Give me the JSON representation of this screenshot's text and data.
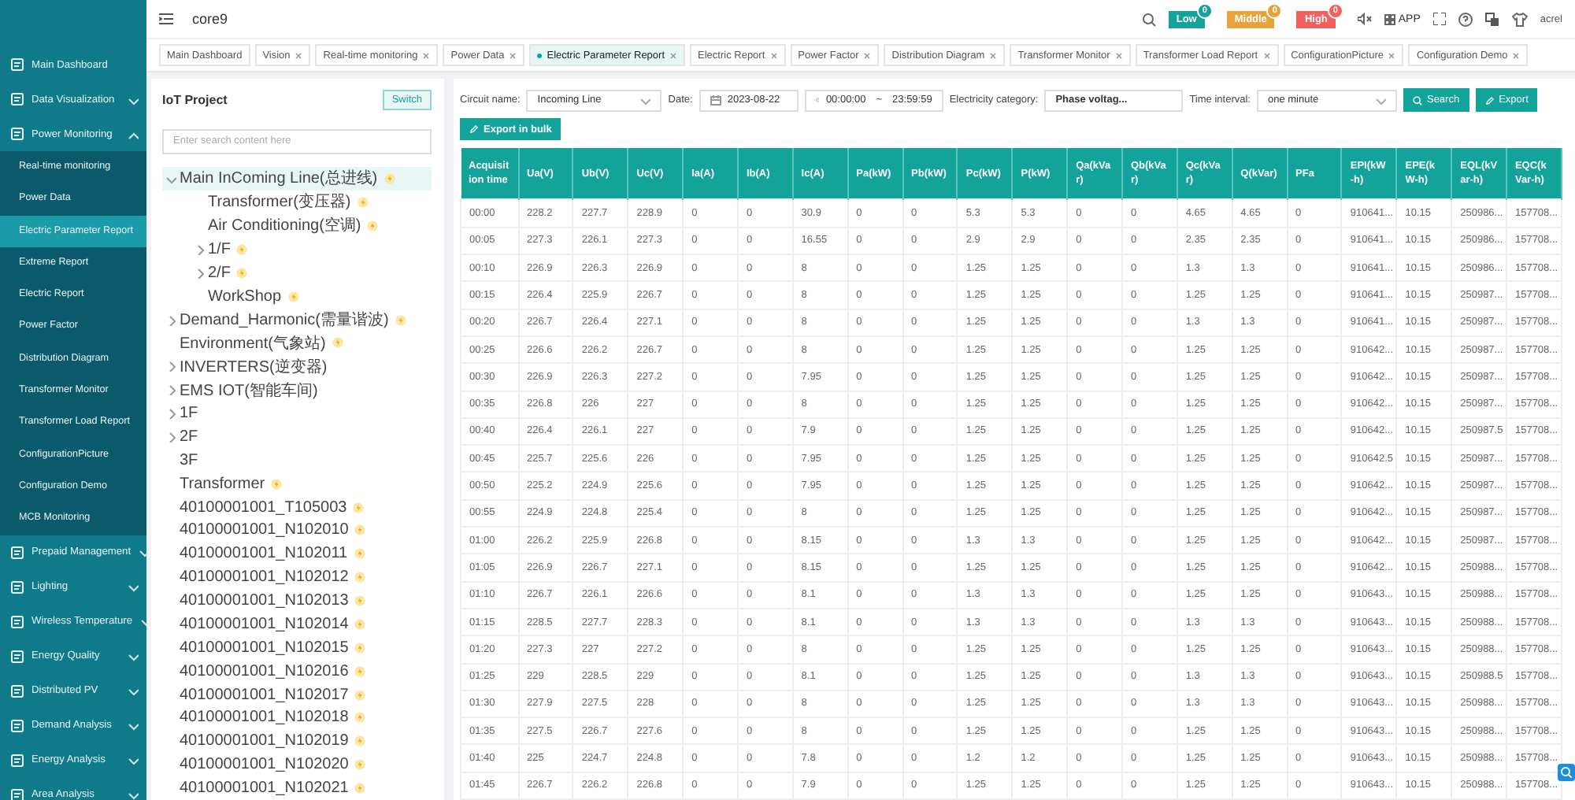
{
  "sidebar": {
    "items": [
      {
        "label": "Main Dashboard"
      },
      {
        "label": "Data Visualization",
        "expanded": false
      },
      {
        "label": "Power Monitoring",
        "expanded": true,
        "children": [
          {
            "label": "Real-time monitoring",
            "selected": false
          },
          {
            "label": "Power Data",
            "selected": false
          },
          {
            "label": "Electric Parameter Report",
            "selected": true
          },
          {
            "label": "Extreme Report",
            "selected": false
          },
          {
            "label": "Electric Report",
            "selected": false
          },
          {
            "label": "Power Factor",
            "selected": false
          },
          {
            "label": "Distribution Diagram",
            "selected": false
          },
          {
            "label": "Transformer Monitor",
            "selected": false
          },
          {
            "label": "Transformer Load Report",
            "selected": false
          },
          {
            "label": "ConfigurationPicture",
            "selected": false
          },
          {
            "label": "Configuration Demo",
            "selected": false
          },
          {
            "label": "MCB Monitoring",
            "selected": false
          }
        ]
      },
      {
        "label": "Prepaid Management",
        "expanded": false
      },
      {
        "label": "Lighting",
        "expanded": false
      },
      {
        "label": "Wireless Temperature",
        "expanded": false
      },
      {
        "label": "Energy Quality",
        "expanded": false
      },
      {
        "label": "Distributed PV",
        "expanded": false
      },
      {
        "label": "Demand Analysis",
        "expanded": false
      },
      {
        "label": "Energy Analysis",
        "expanded": false
      },
      {
        "label": "Area Analysis",
        "expanded": false
      }
    ]
  },
  "header": {
    "title": "core9",
    "alerts": [
      {
        "label": "Low",
        "count": "0",
        "color": "#14a39a"
      },
      {
        "label": "Middle",
        "count": "0",
        "color": "#e8a23a"
      },
      {
        "label": "High",
        "count": "0",
        "color": "#f0605d"
      }
    ],
    "app_label": "APP",
    "user": "acrel"
  },
  "tabs": [
    {
      "label": "Main Dashboard",
      "closable": false,
      "selected": false
    },
    {
      "label": "Vision",
      "closable": true,
      "selected": false
    },
    {
      "label": "Real-time monitoring",
      "closable": true,
      "selected": false
    },
    {
      "label": "Power Data",
      "closable": true,
      "selected": false
    },
    {
      "label": "Electric Parameter Report",
      "closable": true,
      "selected": true
    },
    {
      "label": "Electric Report",
      "closable": true,
      "selected": false
    },
    {
      "label": "Power Factor",
      "closable": true,
      "selected": false
    },
    {
      "label": "Distribution Diagram",
      "closable": true,
      "selected": false
    },
    {
      "label": "Transformer Monitor",
      "closable": true,
      "selected": false
    },
    {
      "label": "Transformer Load Report",
      "closable": true,
      "selected": false
    },
    {
      "label": "ConfigurationPicture",
      "closable": true,
      "selected": false
    },
    {
      "label": "Configuration Demo",
      "closable": true,
      "selected": false
    }
  ],
  "project_panel": {
    "title": "IoT Project",
    "switch_button": "Switch",
    "search": {
      "placeholder": "Enter search content here"
    },
    "tree": [
      {
        "label": "Main InComing Line(总进线)",
        "marked": true,
        "selected": true,
        "expanded": true,
        "children": [
          {
            "label": "Transformer(变压器)",
            "marked": true,
            "selected": false
          },
          {
            "label": "Air Conditioning(空调)",
            "marked": true,
            "selected": false
          },
          {
            "label": "1/F",
            "marked": true,
            "selected": false,
            "expanded": false
          },
          {
            "label": "2/F",
            "marked": true,
            "selected": false,
            "expanded": false
          },
          {
            "label": "WorkShop",
            "marked": true,
            "selected": false
          }
        ]
      },
      {
        "label": "Demand_Harmonic(需量谐波)",
        "marked": true,
        "selected": false,
        "expanded": false
      },
      {
        "label": "Environment(气象站)",
        "marked": true,
        "selected": false
      },
      {
        "label": "INVERTERS(逆变器)",
        "marked": false,
        "selected": false,
        "expanded": false
      },
      {
        "label": "EMS IOT(智能车间)",
        "marked": false,
        "selected": false,
        "expanded": false
      },
      {
        "label": "1F",
        "marked": false,
        "selected": false,
        "expanded": false
      },
      {
        "label": "2F",
        "marked": false,
        "selected": false,
        "expanded": false
      },
      {
        "label": "3F",
        "marked": false,
        "selected": false
      },
      {
        "label": "Transformer",
        "marked": true,
        "selected": false
      },
      {
        "label": "40100001001_T105003",
        "marked": true,
        "selected": false
      },
      {
        "label": "40100001001_N102010",
        "marked": true,
        "selected": false
      },
      {
        "label": "40100001001_N102011",
        "marked": true,
        "selected": false
      },
      {
        "label": "40100001001_N102012",
        "marked": true,
        "selected": false
      },
      {
        "label": "40100001001_N102013",
        "marked": true,
        "selected": false
      },
      {
        "label": "40100001001_N102014",
        "marked": true,
        "selected": false
      },
      {
        "label": "40100001001_N102015",
        "marked": true,
        "selected": false
      },
      {
        "label": "40100001001_N102016",
        "marked": true,
        "selected": false
      },
      {
        "label": "40100001001_N102017",
        "marked": true,
        "selected": false
      },
      {
        "label": "40100001001_N102018",
        "marked": true,
        "selected": false
      },
      {
        "label": "40100001001_N102019",
        "marked": true,
        "selected": false
      },
      {
        "label": "40100001001_N102020",
        "marked": true,
        "selected": false
      },
      {
        "label": "40100001001_N102021",
        "marked": true,
        "selected": false
      }
    ]
  },
  "report": {
    "filters": {
      "circuit_name": {
        "label": "Circuit name:",
        "value": "Incoming Line"
      },
      "date": {
        "label": "Date:",
        "value": "2023-08-22"
      },
      "time_range": {
        "start": "00:00:00",
        "separator": "~",
        "end": "23:59:59"
      },
      "electricity_category": {
        "label": "Electricity category:",
        "value": "Phase voltag..."
      },
      "time_interval": {
        "label": "Time interval:",
        "value": "one minute"
      }
    },
    "buttons": {
      "search": "Search",
      "export": "Export",
      "export_bulk": "Export in bulk"
    },
    "table": {
      "columns": [
        "Acquisition time",
        "Ua(V)",
        "Ub(V)",
        "Uc(V)",
        "Ia(A)",
        "Ib(A)",
        "Ic(A)",
        "Pa(kW)",
        "Pb(kW)",
        "Pc(kW)",
        "P(kW)",
        "Qa(kVar)",
        "Qb(kVar)",
        "Qc(kVar)",
        "Q(kVar)",
        "PFa",
        "EPI(kW-h)",
        "EPE(kW-h)",
        "EQL(kVar-h)",
        "EQC(kVar-h)"
      ],
      "rows": [
        [
          "00:00",
          "228.2",
          "227.7",
          "228.9",
          "0",
          "0",
          "30.9",
          "0",
          "0",
          "5.3",
          "5.3",
          "0",
          "0",
          "4.65",
          "4.65",
          "0",
          "910641...",
          "10.15",
          "250986...",
          "157708..."
        ],
        [
          "00:05",
          "227.3",
          "226.1",
          "227.3",
          "0",
          "0",
          "16.55",
          "0",
          "0",
          "2.9",
          "2.9",
          "0",
          "0",
          "2.35",
          "2.35",
          "0",
          "910641...",
          "10.15",
          "250986...",
          "157708..."
        ],
        [
          "00:10",
          "226.9",
          "226.3",
          "226.9",
          "0",
          "0",
          "8",
          "0",
          "0",
          "1.25",
          "1.25",
          "0",
          "0",
          "1.3",
          "1.3",
          "0",
          "910641...",
          "10.15",
          "250986...",
          "157708..."
        ],
        [
          "00:15",
          "226.4",
          "225.9",
          "226.7",
          "0",
          "0",
          "8",
          "0",
          "0",
          "1.25",
          "1.25",
          "0",
          "0",
          "1.25",
          "1.25",
          "0",
          "910641...",
          "10.15",
          "250987...",
          "157708..."
        ],
        [
          "00:20",
          "226.7",
          "226.4",
          "227.1",
          "0",
          "0",
          "8",
          "0",
          "0",
          "1.25",
          "1.25",
          "0",
          "0",
          "1.3",
          "1.3",
          "0",
          "910641...",
          "10.15",
          "250987...",
          "157708..."
        ],
        [
          "00:25",
          "226.6",
          "226.2",
          "226.7",
          "0",
          "0",
          "8",
          "0",
          "0",
          "1.25",
          "1.25",
          "0",
          "0",
          "1.25",
          "1.25",
          "0",
          "910642...",
          "10.15",
          "250987...",
          "157708..."
        ],
        [
          "00:30",
          "226.9",
          "226.3",
          "227.2",
          "0",
          "0",
          "7.95",
          "0",
          "0",
          "1.25",
          "1.25",
          "0",
          "0",
          "1.25",
          "1.25",
          "0",
          "910642...",
          "10.15",
          "250987...",
          "157708..."
        ],
        [
          "00:35",
          "226.8",
          "226",
          "227",
          "0",
          "0",
          "8",
          "0",
          "0",
          "1.25",
          "1.25",
          "0",
          "0",
          "1.25",
          "1.25",
          "0",
          "910642...",
          "10.15",
          "250987...",
          "157708..."
        ],
        [
          "00:40",
          "226.4",
          "226.1",
          "227",
          "0",
          "0",
          "7.9",
          "0",
          "0",
          "1.25",
          "1.25",
          "0",
          "0",
          "1.25",
          "1.25",
          "0",
          "910642...",
          "10.15",
          "250987.5",
          "157708..."
        ],
        [
          "00:45",
          "225.7",
          "225.6",
          "226",
          "0",
          "0",
          "7.95",
          "0",
          "0",
          "1.25",
          "1.25",
          "0",
          "0",
          "1.25",
          "1.25",
          "0",
          "910642.5",
          "10.15",
          "250987...",
          "157708..."
        ],
        [
          "00:50",
          "225.2",
          "224.9",
          "225.6",
          "0",
          "0",
          "7.95",
          "0",
          "0",
          "1.25",
          "1.25",
          "0",
          "0",
          "1.25",
          "1.25",
          "0",
          "910642...",
          "10.15",
          "250987...",
          "157708..."
        ],
        [
          "00:55",
          "224.9",
          "224.8",
          "225.4",
          "0",
          "0",
          "8",
          "0",
          "0",
          "1.25",
          "1.25",
          "0",
          "0",
          "1.25",
          "1.25",
          "0",
          "910642...",
          "10.15",
          "250987...",
          "157708..."
        ],
        [
          "01:00",
          "226.2",
          "225.9",
          "226.8",
          "0",
          "0",
          "8.15",
          "0",
          "0",
          "1.3",
          "1.3",
          "0",
          "0",
          "1.25",
          "1.25",
          "0",
          "910642...",
          "10.15",
          "250987...",
          "157708..."
        ],
        [
          "01:05",
          "226.9",
          "226.7",
          "227.1",
          "0",
          "0",
          "8.15",
          "0",
          "0",
          "1.25",
          "1.25",
          "0",
          "0",
          "1.25",
          "1.25",
          "0",
          "910642...",
          "10.15",
          "250988...",
          "157708..."
        ],
        [
          "01:10",
          "226.7",
          "226.1",
          "226.6",
          "0",
          "0",
          "8.1",
          "0",
          "0",
          "1.3",
          "1.3",
          "0",
          "0",
          "1.25",
          "1.25",
          "0",
          "910643...",
          "10.15",
          "250988...",
          "157708..."
        ],
        [
          "01:15",
          "228.5",
          "227.7",
          "228.3",
          "0",
          "0",
          "8.1",
          "0",
          "0",
          "1.3",
          "1.3",
          "0",
          "0",
          "1.3",
          "1.3",
          "0",
          "910643...",
          "10.15",
          "250988...",
          "157708..."
        ],
        [
          "01:20",
          "227.3",
          "227",
          "227.2",
          "0",
          "0",
          "8",
          "0",
          "0",
          "1.25",
          "1.25",
          "0",
          "0",
          "1.25",
          "1.25",
          "0",
          "910643...",
          "10.15",
          "250988...",
          "157708..."
        ],
        [
          "01:25",
          "229",
          "228.5",
          "229",
          "0",
          "0",
          "8.1",
          "0",
          "0",
          "1.25",
          "1.25",
          "0",
          "0",
          "1.3",
          "1.3",
          "0",
          "910643...",
          "10.15",
          "250988.5",
          "157708..."
        ],
        [
          "01:30",
          "227.9",
          "227.5",
          "228",
          "0",
          "0",
          "8",
          "0",
          "0",
          "1.25",
          "1.25",
          "0",
          "0",
          "1.3",
          "1.3",
          "0",
          "910643...",
          "10.15",
          "250988...",
          "157708..."
        ],
        [
          "01:35",
          "227.5",
          "226.7",
          "227.6",
          "0",
          "0",
          "8",
          "0",
          "0",
          "1.25",
          "1.25",
          "0",
          "0",
          "1.25",
          "1.25",
          "0",
          "910643...",
          "10.15",
          "250988...",
          "157708..."
        ],
        [
          "01:40",
          "225",
          "224.7",
          "224.8",
          "0",
          "0",
          "7.8",
          "0",
          "0",
          "1.2",
          "1.2",
          "0",
          "0",
          "1.25",
          "1.25",
          "0",
          "910643...",
          "10.15",
          "250988...",
          "157708..."
        ],
        [
          "01:45",
          "226.7",
          "226.2",
          "226.8",
          "0",
          "0",
          "7.9",
          "0",
          "0",
          "1.25",
          "1.25",
          "0",
          "0",
          "1.25",
          "1.25",
          "0",
          "910643...",
          "10.15",
          "250988...",
          "157708..."
        ]
      ]
    }
  }
}
